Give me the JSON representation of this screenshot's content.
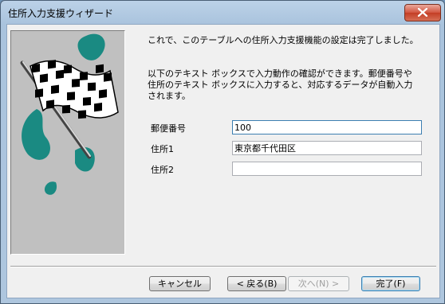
{
  "window": {
    "title": "住所入力支援ウィザード"
  },
  "message": {
    "completion": "これで、このテーブルへの住所入力支援機能の設定は完了しました。",
    "instruction": "以下のテキスト ボックスで入力動作の確認ができます。郵便番号や住所のテキスト ボックスに入力すると、対応するデータが自動入力されます。"
  },
  "fields": {
    "postal_code": {
      "label": "郵便番号",
      "value": "100"
    },
    "address1": {
      "label": "住所1",
      "value": "東京都千代田区"
    },
    "address2": {
      "label": "住所2",
      "value": ""
    }
  },
  "buttons": {
    "cancel": "キャンセル",
    "back": "< 戻る(B)",
    "next": "次へ(N) >",
    "finish": "完了(F)"
  },
  "colors": {
    "accent": "#3c7fb1",
    "flag_teal": "#1a8a82",
    "panel_gray": "#c0c0c0"
  },
  "icons": {
    "close": "close-icon",
    "finish_flag": "checkered-flag-illustration"
  }
}
